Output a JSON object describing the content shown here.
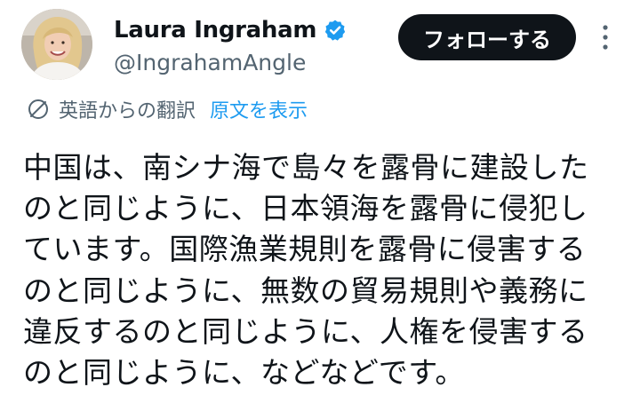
{
  "author": {
    "display_name": "Laura Ingraham",
    "handle": "@IngrahamAngle",
    "verified": true,
    "avatar_icon": "profile-photo"
  },
  "actions": {
    "follow_label": "フォローする",
    "more_icon": "more-vertical-icon"
  },
  "translation": {
    "label": "英語からの翻訳",
    "show_original": "原文を表示",
    "icon": "translate-icon"
  },
  "tweet": {
    "lines": [
      "中国は、南シナ海で島々を露骨に建設した",
      "のと同じように、日本領海を露骨に侵犯し",
      "ています。国際漁業規則を露骨に侵害する",
      "のと同じように、無数の貿易規則や義務に",
      "違反するのと同じように、人権を侵害する",
      "のと同じように、などなどです。"
    ]
  },
  "colors": {
    "text_primary": "#0f1419",
    "text_secondary": "#536471",
    "link_blue": "#1d9bf0",
    "button_bg": "#0f1419",
    "button_text": "#ffffff",
    "verified_badge": "#1d9bf0"
  }
}
